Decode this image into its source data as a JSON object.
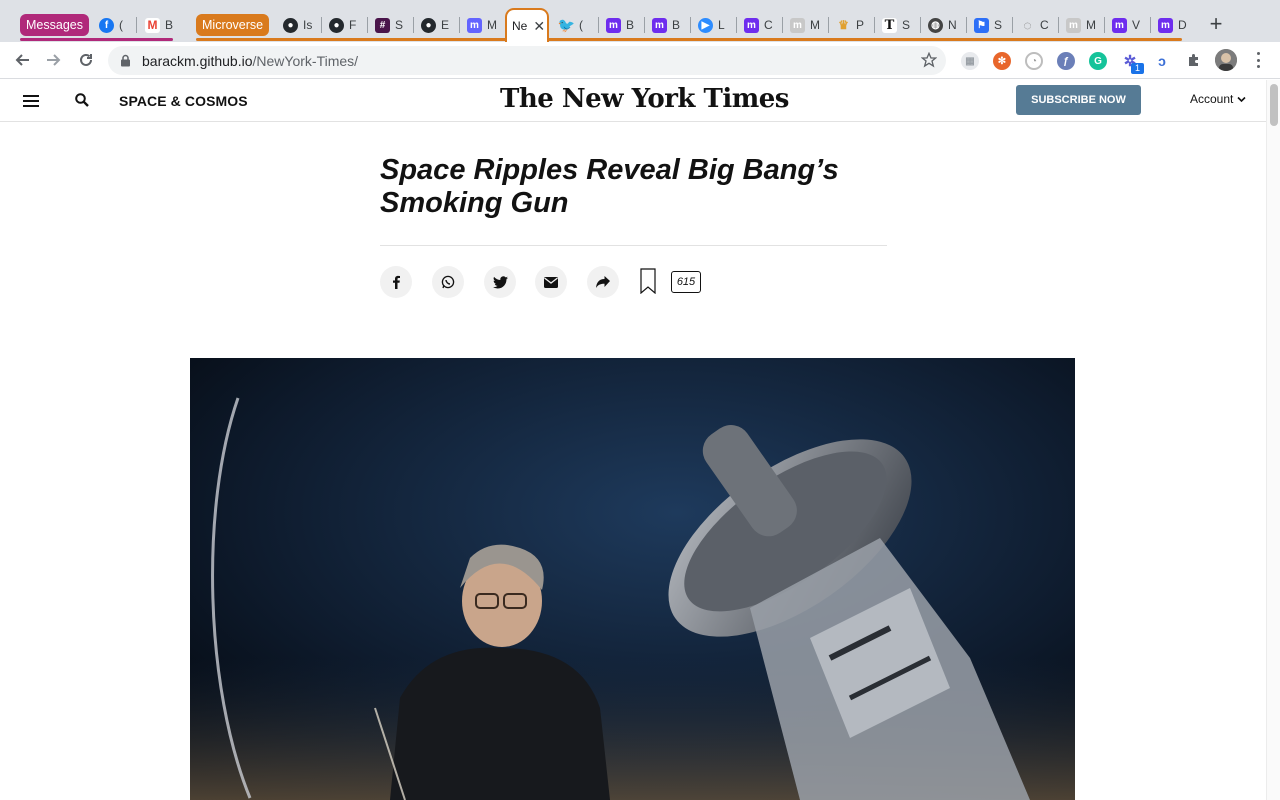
{
  "browser": {
    "tab_groups": [
      {
        "label": "Messages",
        "color": "#b0297a"
      },
      {
        "label": "Microverse",
        "color": "#d97a1d"
      }
    ],
    "tabs": [
      {
        "title": "(",
        "icon": "facebook-icon",
        "color": "#1877f2"
      },
      {
        "title": "B",
        "icon": "gmail-icon",
        "color": "#ea4335"
      },
      {
        "title": "Is",
        "icon": "github-icon",
        "color": "#24292e"
      },
      {
        "title": "F",
        "icon": "github-icon",
        "color": "#24292e"
      },
      {
        "title": "S",
        "icon": "slack-icon",
        "color": "#4a154b"
      },
      {
        "title": "E",
        "icon": "github-icon",
        "color": "#24292e"
      },
      {
        "title": "M",
        "icon": "mastodon-icon",
        "color": "#6364ff"
      },
      {
        "title": "Ne",
        "icon": "nyt-icon",
        "color": "#121212"
      },
      {
        "title": "(",
        "icon": "twitter-icon",
        "color": "#1da1f2"
      },
      {
        "title": "B",
        "icon": "microverse-icon",
        "color": "#6e2dee"
      },
      {
        "title": "B",
        "icon": "microverse-icon",
        "color": "#6e2dee"
      },
      {
        "title": "L",
        "icon": "zoom-icon",
        "color": "#2d8cff"
      },
      {
        "title": "C",
        "icon": "microverse-icon",
        "color": "#6e2dee"
      },
      {
        "title": "M",
        "icon": "microverse-icon",
        "color": "#a8a8a8"
      },
      {
        "title": "P",
        "icon": "pumpkin-icon",
        "color": "#e0a030"
      },
      {
        "title": "S",
        "icon": "nyt-icon",
        "color": "#121212"
      },
      {
        "title": "N",
        "icon": "globe-icon",
        "color": "#444444"
      },
      {
        "title": "S",
        "icon": "flag-icon",
        "color": "#2d6ff7"
      },
      {
        "title": "C",
        "icon": "loader-icon",
        "color": "#7a7a7a"
      },
      {
        "title": "M",
        "icon": "microverse-icon",
        "color": "#a8a8a8"
      },
      {
        "title": "V",
        "icon": "microverse-icon",
        "color": "#6e2dee"
      },
      {
        "title": "D",
        "icon": "microverse-icon",
        "color": "#6e2dee"
      }
    ],
    "active_tab": {
      "title": "Ne",
      "close": "✕"
    },
    "new_tab": "+",
    "url": {
      "host": "barackm.github.io",
      "path": "/NewYork-Times/"
    },
    "extension_badge": "1"
  },
  "nyt": {
    "section": "SPACE & COSMOS",
    "logo": "The New York Times",
    "subscribe": "SUBSCRIBE NOW",
    "account": "Account",
    "headline": "Space Ripples Reveal Big Bang’s Smoking Gun",
    "comment_count": "615",
    "share_icons": [
      "facebook-icon",
      "whatsapp-icon",
      "twitter-icon",
      "email-icon",
      "share-icon"
    ]
  },
  "colors": {
    "accent": "#d97a1d",
    "group_messages": "#b0297a",
    "subscribe": "#567b95"
  }
}
